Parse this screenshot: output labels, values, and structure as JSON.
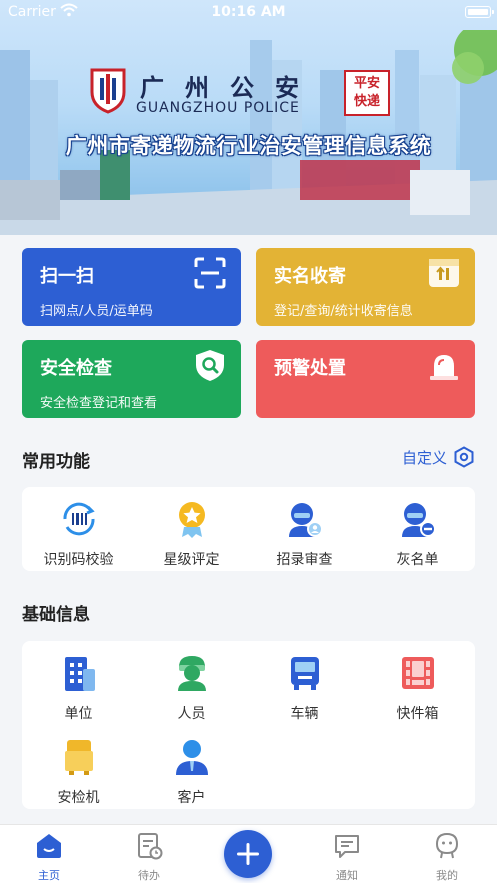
{
  "status_bar": {
    "carrier": "Carrier",
    "time": "10:16 AM"
  },
  "banner": {
    "logo_title": "广州公安",
    "logo_subtitle": "GUANGZHOU POLICE",
    "seal_line1": "平安",
    "seal_line2": "快递",
    "system_title": "广州市寄递物流行业治安管理信息系统"
  },
  "cards": [
    {
      "title": "扫一扫",
      "subtitle": "扫网点/人员/运单码",
      "color": "#2d5fd3",
      "icon": "scan-icon"
    },
    {
      "title": "实名收寄",
      "subtitle": "登记/查询/统计收寄信息",
      "color": "#e3b335",
      "icon": "parcel-icon"
    },
    {
      "title": "安全检查",
      "subtitle": "安全检查登记和查看",
      "color": "#1ea85b",
      "icon": "shield-search-icon"
    },
    {
      "title": "预警处置",
      "subtitle": "",
      "color": "#ee5b5b",
      "icon": "alarm-light-icon"
    }
  ],
  "common": {
    "title": "常用功能",
    "customize": "自定义",
    "items": [
      {
        "label": "识别码校验",
        "icon": "barcode-check-icon"
      },
      {
        "label": "星级评定",
        "icon": "star-medal-icon"
      },
      {
        "label": "招录审查",
        "icon": "recruit-review-icon"
      },
      {
        "label": "灰名单",
        "icon": "greylist-icon"
      }
    ]
  },
  "basic": {
    "title": "基础信息",
    "items": [
      {
        "label": "单位",
        "icon": "building-icon"
      },
      {
        "label": "人员",
        "icon": "person-icon"
      },
      {
        "label": "车辆",
        "icon": "bus-icon"
      },
      {
        "label": "快件箱",
        "icon": "locker-icon"
      },
      {
        "label": "安检机",
        "icon": "xray-machine-icon"
      },
      {
        "label": "客户",
        "icon": "customer-icon"
      }
    ]
  },
  "tabbar": {
    "items": [
      {
        "label": "主页",
        "icon": "home-icon",
        "active": true
      },
      {
        "label": "待办",
        "icon": "todo-icon",
        "active": false
      },
      {
        "label": "",
        "icon": "plus-icon",
        "active": false
      },
      {
        "label": "通知",
        "icon": "message-icon",
        "active": false
      },
      {
        "label": "我的",
        "icon": "profile-icon",
        "active": false
      }
    ]
  },
  "colors": {
    "accent": "#2d5fd3",
    "background": "#f3f5f8"
  }
}
